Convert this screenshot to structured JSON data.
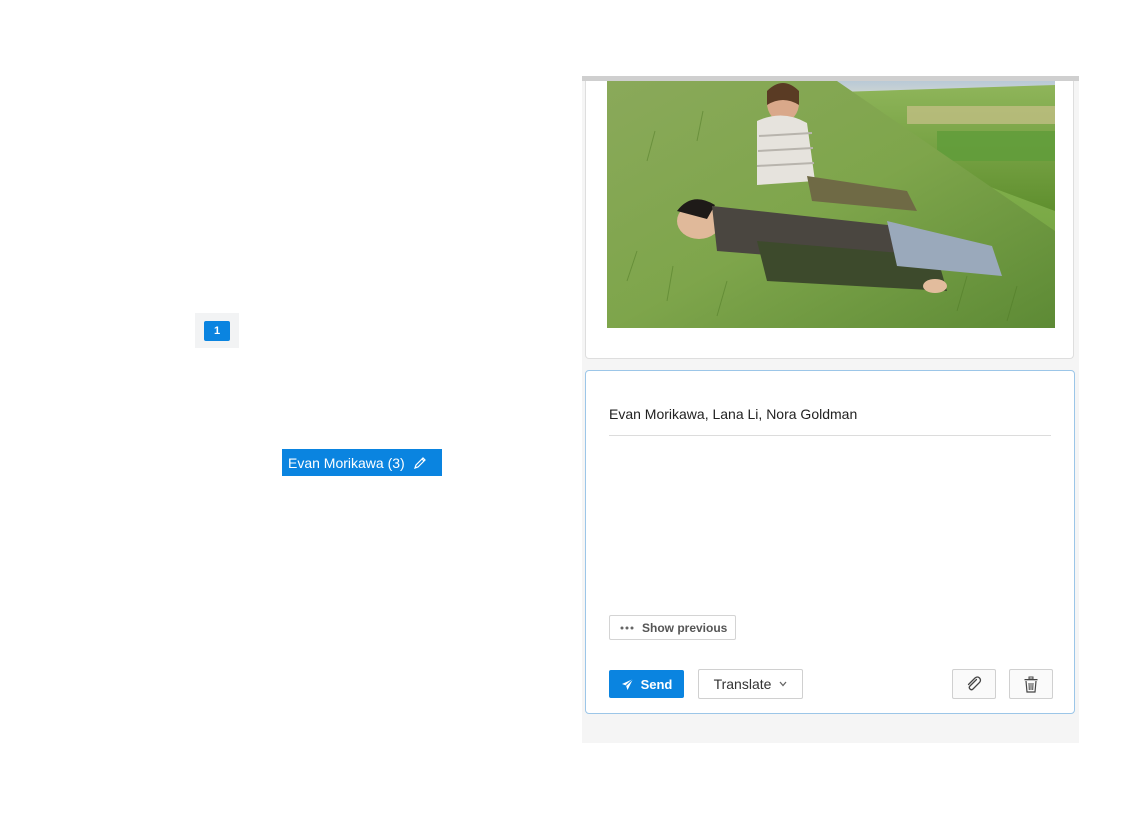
{
  "pagination": {
    "current_page": "1"
  },
  "recipient_chip": {
    "label": "Evan Morikawa (3)",
    "icon": "pencil-icon"
  },
  "panel": {
    "photo": {
      "alt": "photo"
    },
    "compose": {
      "to": "Evan Morikawa, Lana Li, Nora Goldman",
      "show_previous": "Show previous",
      "send_label": "Send",
      "translate_label": "Translate",
      "attach_icon": "paperclip-icon",
      "trash_icon": "trash-icon"
    }
  },
  "colors": {
    "accent": "#0a84e0",
    "compose_border": "#9cc6e8"
  }
}
